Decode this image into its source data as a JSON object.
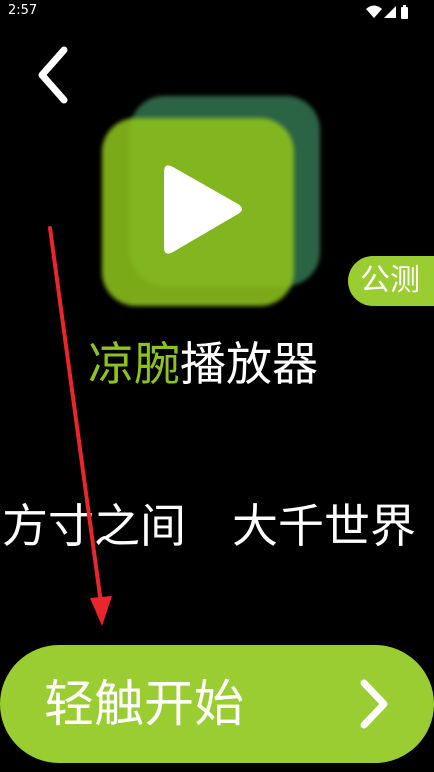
{
  "status_bar": {
    "time": "2:57",
    "icons": [
      "wifi-icon",
      "signal-icon",
      "battery-icon"
    ]
  },
  "header": {
    "back_icon": "chevron-left-icon"
  },
  "logo": {
    "icon": "play-icon",
    "colors": {
      "front": "#8DC21F",
      "back": "#2F6B4A",
      "play": "#ffffff"
    }
  },
  "badge": {
    "label": "公测"
  },
  "app_name": {
    "accent_part": "凉腕",
    "rest_part": "播放器"
  },
  "slogan": {
    "text": "方寸之间　大千世界"
  },
  "start_button": {
    "label": "轻触开始",
    "icon": "chevron-right-icon"
  },
  "colors": {
    "accent": "#9ACD32",
    "background": "#000000",
    "annotation": "#E8262B"
  }
}
